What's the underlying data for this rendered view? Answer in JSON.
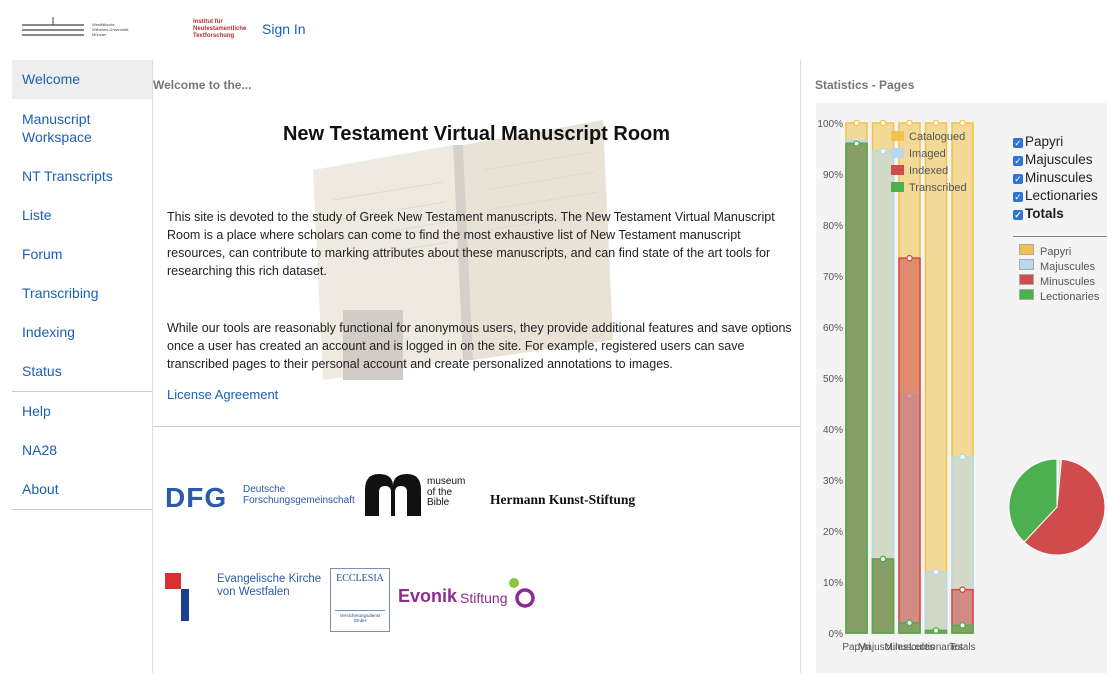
{
  "header": {
    "wwu_lines": [
      "Westfälische",
      "Wilhelms-Universität",
      "Münster"
    ],
    "institute_lines": [
      "Institut für",
      "Neutestamentliche",
      "Textforschung"
    ],
    "sign_in": "Sign In"
  },
  "sidebar": {
    "items": [
      {
        "label": "Welcome",
        "active": true
      },
      {
        "label": "Manuscript Workspace"
      },
      {
        "label": "NT Transcripts"
      },
      {
        "label": "Liste"
      },
      {
        "label": "Forum"
      },
      {
        "label": "Transcribing"
      },
      {
        "label": "Indexing"
      },
      {
        "label": "Status"
      },
      {
        "label": "Help"
      },
      {
        "label": "NA28"
      },
      {
        "label": "About"
      }
    ]
  },
  "main": {
    "section_title": "Welcome to the...",
    "title": "New Testament Virtual Manuscript Room",
    "para1": "This site is devoted to the study of Greek New Testament manuscripts. The New Testament Virtual Manuscript Room is a place where scholars can come to find the most exhaustive list of New Testament manuscript resources, can contribute to marking attributes about these manuscripts, and can find state of the art tools for researching this rich dataset.",
    "para2": "While our tools are reasonably functional for anonymous users, they provide additional features and save options once a user has created an account and is logged in on the site. For example, registered users can save transcribed pages to their personal account and create personalized annotations to images.",
    "license": "License Agreement"
  },
  "sponsors": {
    "dfg_mark": "DFG",
    "dfg_lines": [
      "Deutsche",
      "Forschungsgemeinschaft"
    ],
    "museum_lines": [
      "museum",
      "of the",
      "Bible"
    ],
    "kunst": "Hermann Kunst-Stiftung",
    "ekvw_lines": [
      "Evangelische Kirche",
      "von Westfalen"
    ],
    "ecclesia": "ECCLESIA",
    "ecclesia_sub": [
      "Versicherungsdienst",
      "GmbH"
    ],
    "evonik": "Evonik",
    "stiftung": "Stiftung"
  },
  "stats": {
    "title": "Statistics - Pages",
    "checkboxes": [
      {
        "label": "Papyri",
        "bold": false
      },
      {
        "label": "Majuscules",
        "bold": false
      },
      {
        "label": "Minuscules",
        "bold": false
      },
      {
        "label": "Lectionaries",
        "bold": false
      },
      {
        "label": "Totals",
        "bold": true
      }
    ],
    "pie_legend": [
      {
        "label": "Papyri",
        "color": "#f0c24b"
      },
      {
        "label": "Majuscules",
        "color": "#b8d8ee"
      },
      {
        "label": "Minuscules",
        "color": "#d04b4b"
      },
      {
        "label": "Lectionaries",
        "color": "#4caf50"
      }
    ],
    "pie_values": [
      {
        "label": "Papyri",
        "value": 0.5,
        "color": "#f0c24b"
      },
      {
        "label": "Majuscules",
        "value": 1.0,
        "color": "#b8d8ee"
      },
      {
        "label": "Minuscules",
        "value": 60.5,
        "color": "#d04b4b"
      },
      {
        "label": "Lectionaries",
        "value": 38.0,
        "color": "#4caf50"
      }
    ]
  },
  "chart_data": {
    "type": "bar",
    "categories": [
      "Papyri",
      "Majuscules",
      "Minuscules",
      "Lectionaries",
      "Totals"
    ],
    "ylim": [
      0,
      100
    ],
    "yticks": [
      "0%",
      "10%",
      "20%",
      "30%",
      "40%",
      "50%",
      "60%",
      "70%",
      "80%",
      "90%",
      "100%"
    ],
    "series": [
      {
        "name": "Catalogued",
        "color": "#f0c24b",
        "values": [
          100,
          100,
          100,
          100,
          100
        ]
      },
      {
        "name": "Imaged",
        "color": "#b8d8ee",
        "values": [
          96.5,
          94.5,
          46.5,
          12,
          34.5
        ]
      },
      {
        "name": "Indexed",
        "color": "#d04b4b",
        "values": [
          96,
          14.5,
          73.5,
          0.5,
          8.5
        ]
      },
      {
        "name": "Transcribed",
        "color": "#4caf50",
        "values": [
          96,
          14.5,
          2,
          0.5,
          1.5
        ]
      }
    ],
    "legend_position": "top-right",
    "grid": false
  }
}
